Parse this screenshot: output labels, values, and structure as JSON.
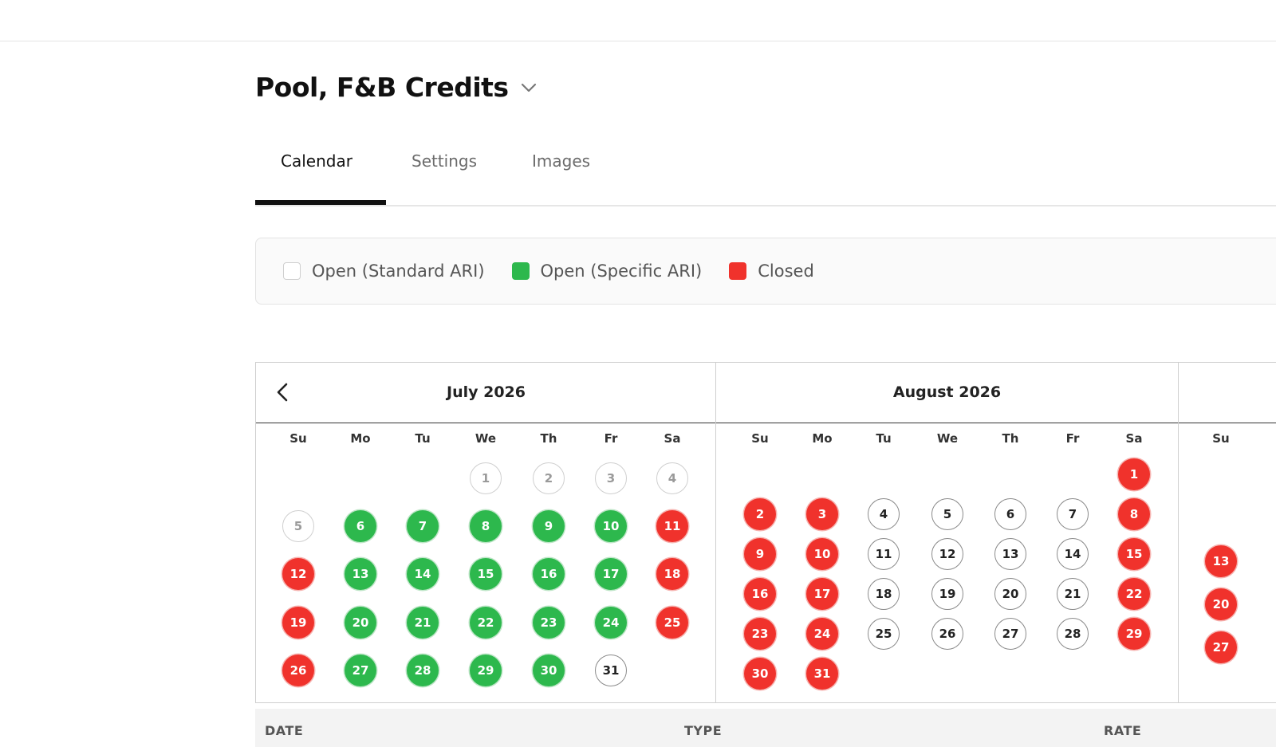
{
  "product": {
    "title": "Pool, F&B Credits"
  },
  "tabs": [
    {
      "label": "Calendar",
      "active": true
    },
    {
      "label": "Settings",
      "active": false
    },
    {
      "label": "Images",
      "active": false
    }
  ],
  "legend": [
    {
      "label": "Open (Standard ARI)",
      "color": "#ffffff"
    },
    {
      "label": "Open (Specific ARI)",
      "color": "#2db84d"
    },
    {
      "label": "Closed",
      "color": "#f0322c"
    }
  ],
  "calendar": {
    "weekdays": [
      "Su",
      "Mo",
      "Tu",
      "We",
      "Th",
      "Fr",
      "Sa"
    ],
    "months": [
      {
        "title": "July 2026",
        "first_weekday": 3,
        "statuses": [
          "past",
          "past",
          "past",
          "past",
          "past",
          "green",
          "green",
          "green",
          "green",
          "green",
          "red",
          "red",
          "green",
          "green",
          "green",
          "green",
          "green",
          "red",
          "red",
          "green",
          "green",
          "green",
          "green",
          "green",
          "red",
          "red",
          "green",
          "green",
          "green",
          "green",
          "open"
        ]
      },
      {
        "title": "August 2026",
        "first_weekday": 6,
        "statuses": [
          "red",
          "red",
          "red",
          "open",
          "open",
          "open",
          "open",
          "red",
          "red",
          "red",
          "open",
          "open",
          "open",
          "open",
          "red",
          "red",
          "red",
          "open",
          "open",
          "open",
          "open",
          "red",
          "red",
          "red",
          "open",
          "open",
          "open",
          "open",
          "red",
          "red",
          "red"
        ]
      },
      {
        "title": "",
        "first_weekday": 2,
        "visible_columns": 1,
        "statuses": [
          "",
          "",
          "",
          "",
          "red",
          "",
          "",
          "",
          "",
          "",
          "",
          "",
          "red",
          "",
          "",
          "",
          "",
          "",
          "",
          "red",
          "",
          "",
          "",
          "",
          "",
          "",
          "red"
        ]
      }
    ]
  },
  "table": {
    "columns": [
      "DATE",
      "TYPE",
      "RATE"
    ]
  }
}
